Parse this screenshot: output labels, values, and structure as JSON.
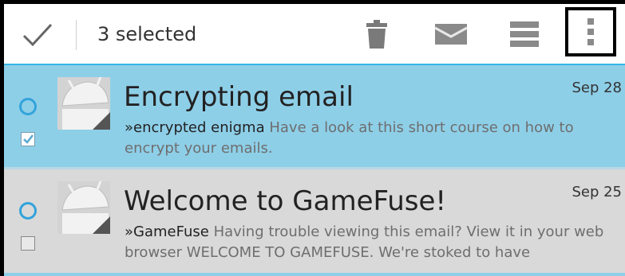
{
  "action_bar": {
    "selected_label": "3 selected",
    "icons": [
      "check-icon",
      "trash-icon",
      "mark-read-icon",
      "label-icon",
      "overflow-menu-icon"
    ],
    "accent_color": "#33b5e5"
  },
  "conversations": [
    {
      "subject": "Encrypting email",
      "date": "Sep 28",
      "sender": "»encrypted enigma",
      "snippet": " Have a look at this short course on how to encrypt your emails.",
      "selected": true,
      "checked": true
    },
    {
      "subject": "Welcome to GameFuse!",
      "date": "Sep 25",
      "sender": "»GameFuse",
      "snippet": " Having trouble viewing this email? View it in your web browser WELCOME TO GAMEFUSE. We're stoked to have",
      "selected": false,
      "checked": false
    }
  ],
  "colors": {
    "selected_row": "#8ecfe8",
    "unselected_row": "#d9d9d9",
    "unread_indicator": "#33a3dc"
  }
}
